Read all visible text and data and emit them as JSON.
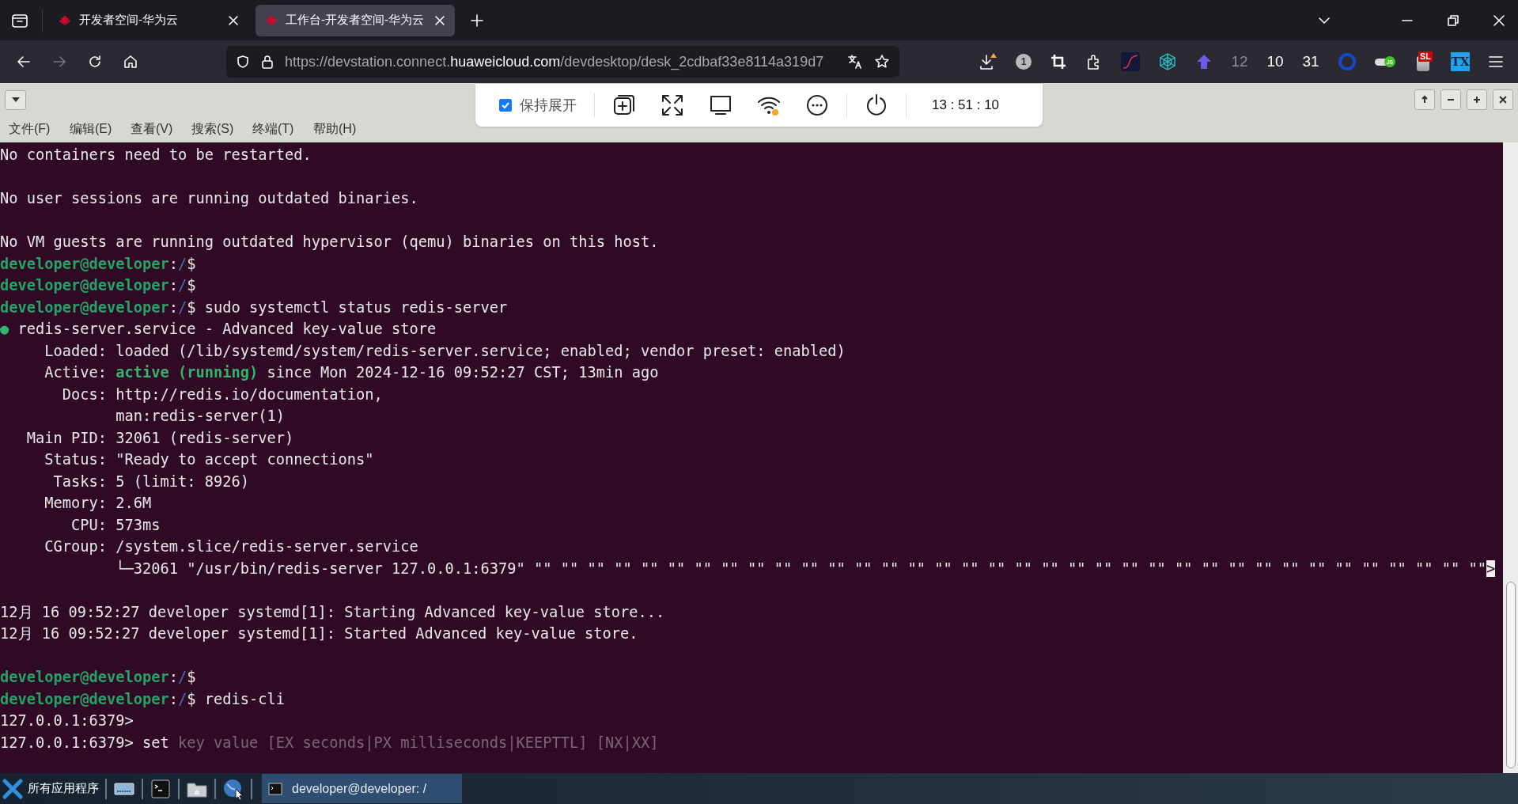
{
  "browser": {
    "tabs": [
      {
        "title": "开发者空间-华为云",
        "selected": false
      },
      {
        "title": "工作台-开发者空间-华为云",
        "selected": true
      }
    ],
    "address_bar": {
      "url_prefix": "https://devstation.connect.",
      "url_domain": "huaweicloud.com",
      "url_path": "/devdesktop/desk_2cdbaf33e8114a319d7"
    },
    "toolbar_items": [
      {
        "kind": "download"
      },
      {
        "kind": "badge",
        "text": "1"
      },
      {
        "kind": "crop"
      },
      {
        "kind": "puzzle"
      },
      {
        "kind": "chart"
      },
      {
        "kind": "web"
      },
      {
        "kind": "arrow"
      },
      {
        "kind": "counter",
        "text": "12",
        "dimmed": true
      },
      {
        "kind": "counter",
        "text": "10",
        "dimmed": false
      },
      {
        "kind": "counter",
        "text": "31",
        "dimmed": false
      },
      {
        "kind": "ring"
      },
      {
        "kind": "toggle",
        "text": "JS"
      },
      {
        "kind": "stack",
        "text": "SL"
      },
      {
        "kind": "square",
        "text": "TX"
      },
      {
        "kind": "menu"
      }
    ]
  },
  "remote_desktop": {
    "toolbar": {
      "keep_expanded": {
        "label": "保持展开",
        "checked": true
      },
      "clock": "13 : 51 : 10"
    },
    "menu": [
      "文件(F)",
      "编辑(E)",
      "查看(V)",
      "搜索(S)",
      "终端(T)",
      "帮助(H)"
    ]
  },
  "terminal": {
    "lines": [
      {
        "space_before": false,
        "segments": [
          {
            "kind": "text",
            "text": "No containers need to be restarted."
          }
        ]
      },
      {
        "space_before": true,
        "segments": [
          {
            "kind": "text",
            "text": "No user sessions are running outdated binaries."
          }
        ]
      },
      {
        "space_before": true,
        "segments": [
          {
            "kind": "text",
            "text": "No VM guests are running outdated hypervisor (qemu) binaries on this host."
          }
        ]
      },
      {
        "space_before": false,
        "segments": [
          {
            "kind": "user",
            "text": "developer@developer"
          },
          {
            "kind": "text",
            "text": ":"
          },
          {
            "kind": "path",
            "text": "/"
          },
          {
            "kind": "text",
            "text": "$"
          }
        ]
      },
      {
        "space_before": false,
        "segments": [
          {
            "kind": "user",
            "text": "developer@developer"
          },
          {
            "kind": "text",
            "text": ":"
          },
          {
            "kind": "path",
            "text": "/"
          },
          {
            "kind": "text",
            "text": "$"
          }
        ]
      },
      {
        "space_before": false,
        "segments": [
          {
            "kind": "user",
            "text": "developer@developer"
          },
          {
            "kind": "text",
            "text": ":"
          },
          {
            "kind": "path",
            "text": "/"
          },
          {
            "kind": "text",
            "text": "$ sudo systemctl status redis-server"
          }
        ]
      },
      {
        "space_before": false,
        "segments": [
          {
            "kind": "dot",
            "text": "●"
          },
          {
            "kind": "text",
            "text": " redis-server.service - Advanced key-value store"
          }
        ]
      },
      {
        "space_before": false,
        "segments": [
          {
            "kind": "text",
            "text": "     Loaded: loaded (/lib/systemd/system/redis-server.service; enabled; vendor preset: enabled)"
          }
        ]
      },
      {
        "space_before": false,
        "segments": [
          {
            "kind": "text",
            "text": "     Active: "
          },
          {
            "kind": "active",
            "text": "active (running)"
          },
          {
            "kind": "text",
            "text": " since Mon 2024-12-16 09:52:27 CST; 13min ago"
          }
        ]
      },
      {
        "space_before": false,
        "segments": [
          {
            "kind": "text",
            "text": "       Docs: http://redis.io/documentation,"
          }
        ]
      },
      {
        "space_before": false,
        "segments": [
          {
            "kind": "text",
            "text": "             man:redis-server(1)"
          }
        ]
      },
      {
        "space_before": false,
        "segments": [
          {
            "kind": "text",
            "text": "   Main PID: 32061 (redis-server)"
          }
        ]
      },
      {
        "space_before": false,
        "segments": [
          {
            "kind": "text",
            "text": "     Status: \"Ready to accept connections\""
          }
        ]
      },
      {
        "space_before": false,
        "segments": [
          {
            "kind": "text",
            "text": "      Tasks: 5 (limit: 8926)"
          }
        ]
      },
      {
        "space_before": false,
        "segments": [
          {
            "kind": "text",
            "text": "     Memory: 2.6M"
          }
        ]
      },
      {
        "space_before": false,
        "segments": [
          {
            "kind": "text",
            "text": "        CPU: 573ms"
          }
        ]
      },
      {
        "space_before": false,
        "segments": [
          {
            "kind": "text",
            "text": "     CGroup: /system.slice/redis-server.service"
          }
        ]
      },
      {
        "space_before": false,
        "segments": [
          {
            "kind": "text",
            "text": "             └─32061 \"/usr/bin/redis-server 127.0.0.1:6379\" \"\" \"\" \"\" \"\" \"\" \"\" \"\" \"\" \"\" \"\" \"\" \"\" \"\" \"\" \"\" \"\" \"\" \"\" \"\" \"\" \"\" \"\" \"\" \"\" \"\" \"\" \"\" \"\" \"\" \"\" \"\" \"\" \"\" \"\" \"\" \"\""
          },
          {
            "kind": "more",
            "text": ">"
          }
        ]
      },
      {
        "space_before": true,
        "segments": [
          {
            "kind": "text",
            "text": "12月 16 09:52:27 developer systemd[1]: Starting Advanced key-value store..."
          }
        ]
      },
      {
        "space_before": false,
        "segments": [
          {
            "kind": "text",
            "text": "12月 16 09:52:27 developer systemd[1]: Started Advanced key-value store."
          }
        ]
      },
      {
        "space_before": true,
        "segments": [
          {
            "kind": "user",
            "text": "developer@developer"
          },
          {
            "kind": "text",
            "text": ":"
          },
          {
            "kind": "path",
            "text": "/"
          },
          {
            "kind": "text",
            "text": "$"
          }
        ]
      },
      {
        "space_before": false,
        "segments": [
          {
            "kind": "user",
            "text": "developer@developer"
          },
          {
            "kind": "text",
            "text": ":"
          },
          {
            "kind": "path",
            "text": "/"
          },
          {
            "kind": "text",
            "text": "$ redis-cli"
          }
        ]
      },
      {
        "space_before": false,
        "segments": [
          {
            "kind": "text",
            "text": "127.0.0.1:6379>"
          }
        ]
      },
      {
        "space_before": false,
        "segments": [
          {
            "kind": "text",
            "text": "127.0.0.1:6379> set "
          },
          {
            "kind": "hint",
            "text": "key value [EX seconds|PX milliseconds|KEEPTTL] [NX|XX]"
          }
        ]
      }
    ]
  },
  "taskbar": {
    "start": "所有应用程序",
    "window": "developer@developer: /"
  }
}
